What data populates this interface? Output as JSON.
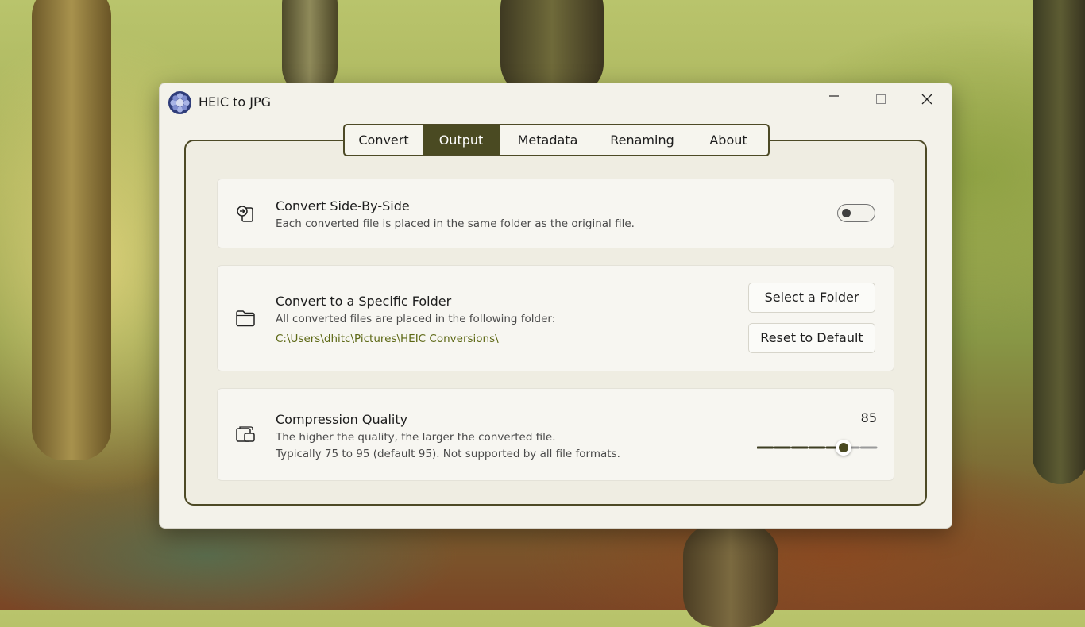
{
  "window": {
    "title": "HEIC to JPG",
    "controls": {
      "minimize": "minimize-icon",
      "maximize": "maximize-icon",
      "close": "close-icon"
    }
  },
  "tabs": {
    "items": [
      {
        "label": "Convert",
        "active": false
      },
      {
        "label": "Output",
        "active": true
      },
      {
        "label": "Metadata",
        "active": false
      },
      {
        "label": "Renaming",
        "active": false
      },
      {
        "label": "About",
        "active": false
      }
    ]
  },
  "side_by_side": {
    "icon": "side-by-side-icon",
    "title": "Convert Side-By-Side",
    "description": "Each converted file is placed in the same folder as the original file.",
    "enabled": false
  },
  "specific_folder": {
    "icon": "folder-icon",
    "title": "Convert to a Specific Folder",
    "description": "All converted files are placed in the following folder:",
    "path": "C:\\Users\\dhitc\\Pictures\\HEIC Conversions\\",
    "select_button": "Select a Folder",
    "reset_button": "Reset to Default"
  },
  "quality": {
    "icon": "compression-icon",
    "title": "Compression Quality",
    "description_line1": "The higher the quality, the larger the converted file.",
    "description_line2": "Typically 75 to 95 (default 95). Not supported by all file formats.",
    "value": "85",
    "slider_fraction": 0.72
  },
  "colors": {
    "accent": "#4a4a22",
    "path_text": "#5d6815"
  }
}
